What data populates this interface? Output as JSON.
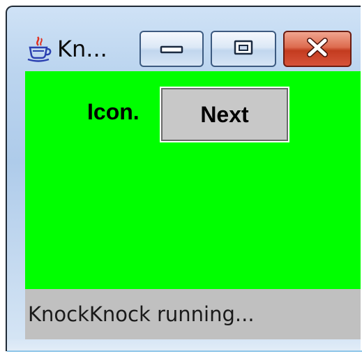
{
  "window": {
    "title": "Kn...",
    "app_icon": "java-coffee-cup-icon",
    "controls": {
      "minimize_icon": "minimize-icon",
      "maximize_icon": "maximize-icon",
      "close_icon": "close-icon"
    }
  },
  "content": {
    "background_color": "#00ff00",
    "label": "Icon.",
    "button_label": "Next"
  },
  "status_bar": {
    "text": "KnockKnock running..."
  }
}
